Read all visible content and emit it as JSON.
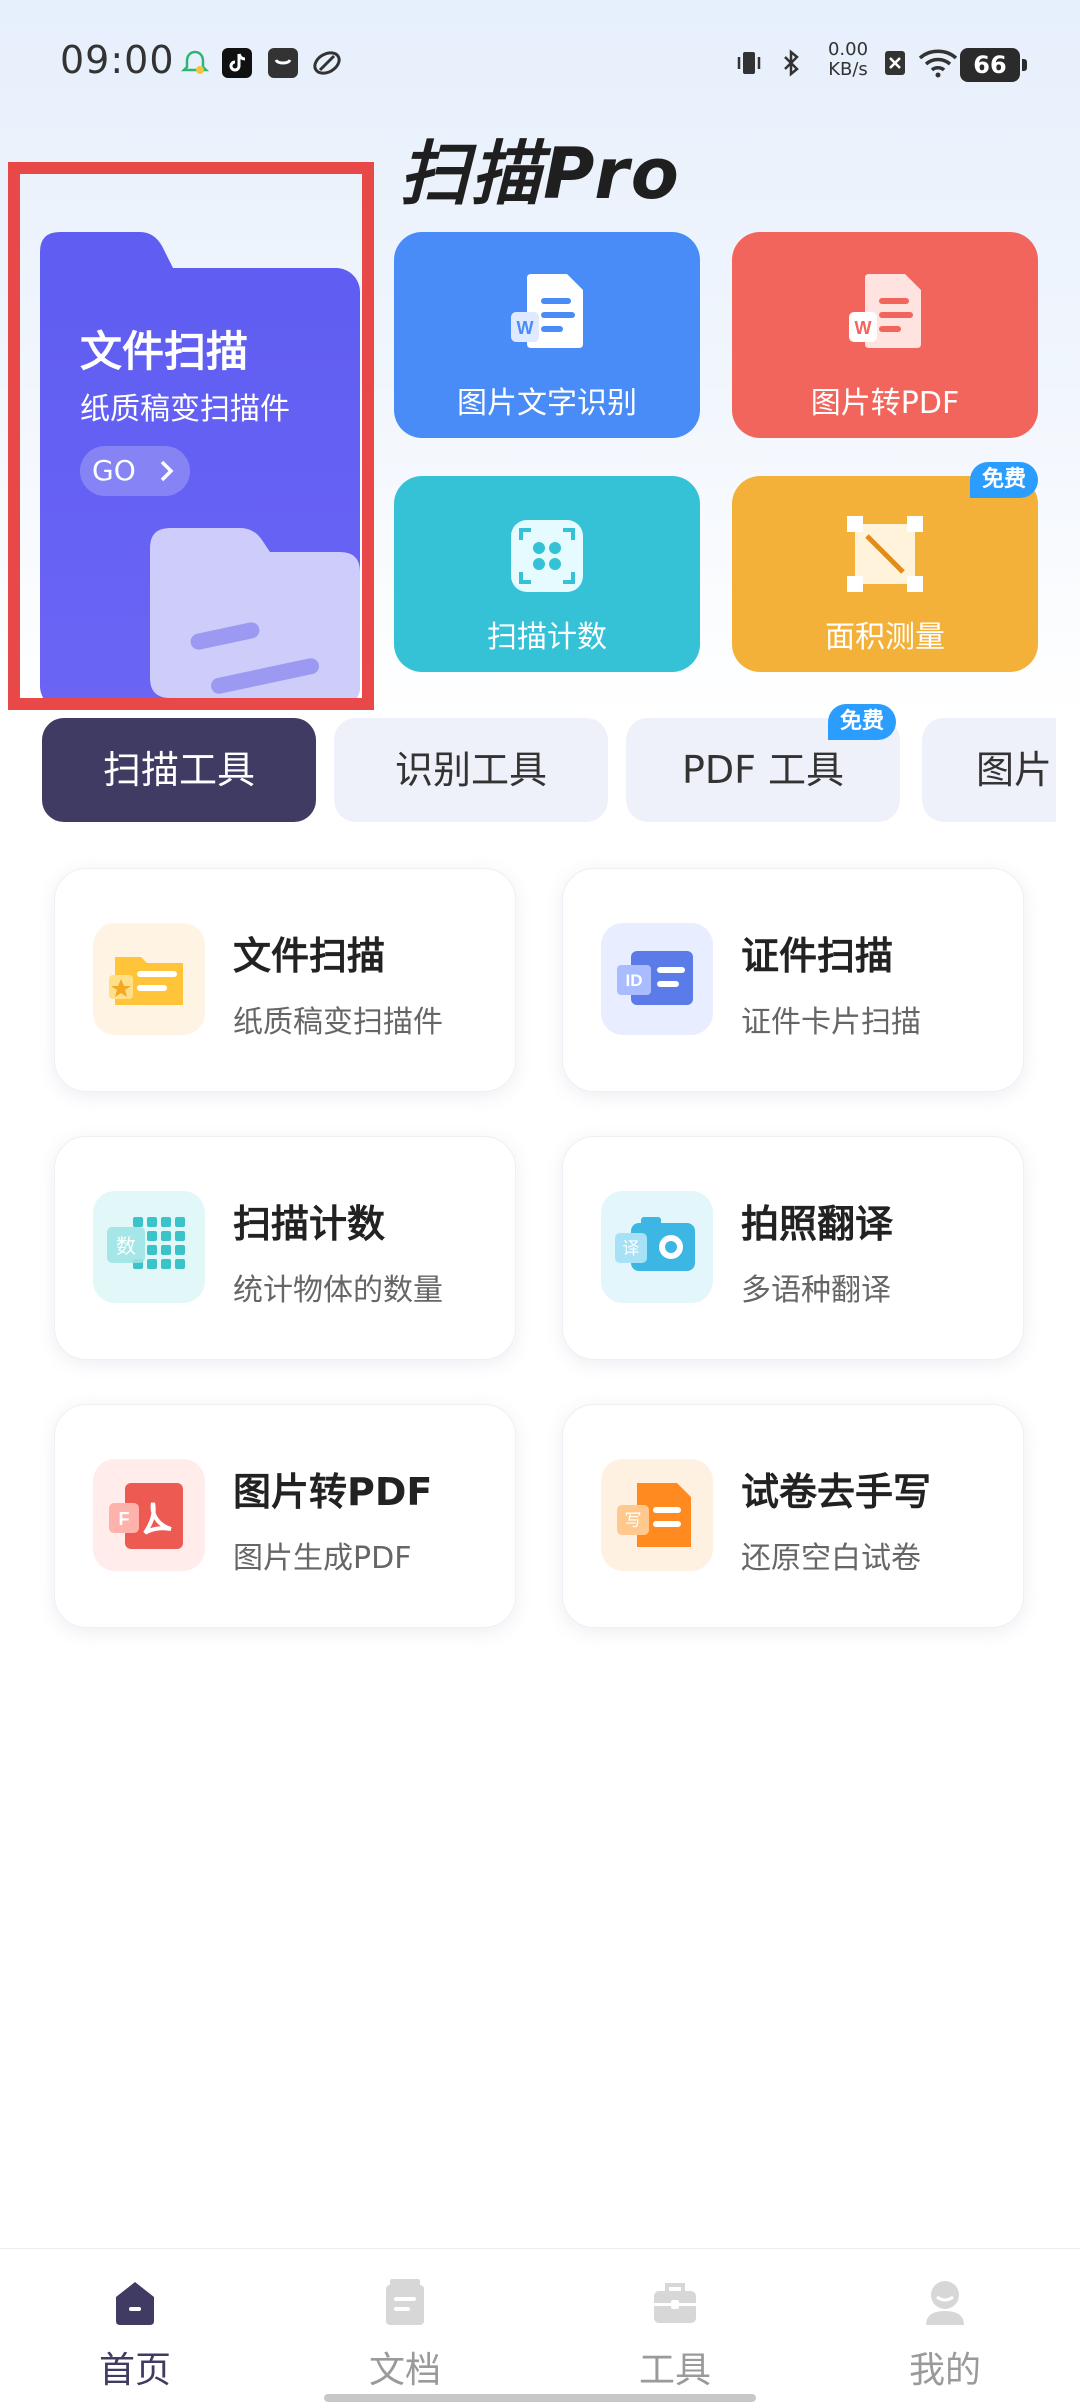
{
  "status_bar": {
    "time": "09:00",
    "net_speed_value": "0.00",
    "net_speed_unit": "KB/s",
    "battery": "66",
    "icons": [
      "notification-icon",
      "tiktok-icon",
      "message-icon",
      "app-icon",
      "vibrate-icon",
      "bluetooth-icon",
      "network-speed",
      "sim-icon",
      "wifi-icon",
      "battery-icon"
    ]
  },
  "app": {
    "title": "扫描Pro"
  },
  "hero": {
    "title": "文件扫描",
    "subtitle": "纸质稿变扫描件",
    "go_label": "GO"
  },
  "features": [
    {
      "label": "图片文字识别",
      "color": "#4a8cf7",
      "icon": "word-doc-icon"
    },
    {
      "label": "图片转PDF",
      "color": "#f2655d",
      "icon": "word-doc-icon"
    },
    {
      "label": "扫描计数",
      "color": "#35c1d6",
      "icon": "scan-count-icon"
    },
    {
      "label": "面积测量",
      "color": "#f4b13a",
      "icon": "area-measure-icon",
      "badge": "免费"
    }
  ],
  "tabs": [
    {
      "label": "扫描工具",
      "active": true
    },
    {
      "label": "识别工具"
    },
    {
      "label": "PDF 工具",
      "badge": "免费"
    },
    {
      "label": "图片"
    }
  ],
  "tools": [
    {
      "title": "文件扫描",
      "subtitle": "纸质稿变扫描件",
      "icon": "folder-scan-icon"
    },
    {
      "title": "证件扫描",
      "subtitle": "证件卡片扫描",
      "icon": "id-card-icon"
    },
    {
      "title": "扫描计数",
      "subtitle": "统计物体的数量",
      "icon": "count-grid-icon"
    },
    {
      "title": "拍照翻译",
      "subtitle": "多语种翻译",
      "icon": "camera-translate-icon"
    },
    {
      "title": "图片转PDF",
      "subtitle": "图片生成PDF",
      "icon": "pdf-icon"
    },
    {
      "title": "试卷去手写",
      "subtitle": "还原空白试卷",
      "icon": "erase-handwriting-icon"
    }
  ],
  "bottom_nav": [
    {
      "label": "首页",
      "active": true,
      "icon": "home-icon"
    },
    {
      "label": "文档",
      "icon": "document-icon"
    },
    {
      "label": "工具",
      "icon": "toolbox-icon"
    },
    {
      "label": "我的",
      "icon": "profile-icon"
    }
  ]
}
